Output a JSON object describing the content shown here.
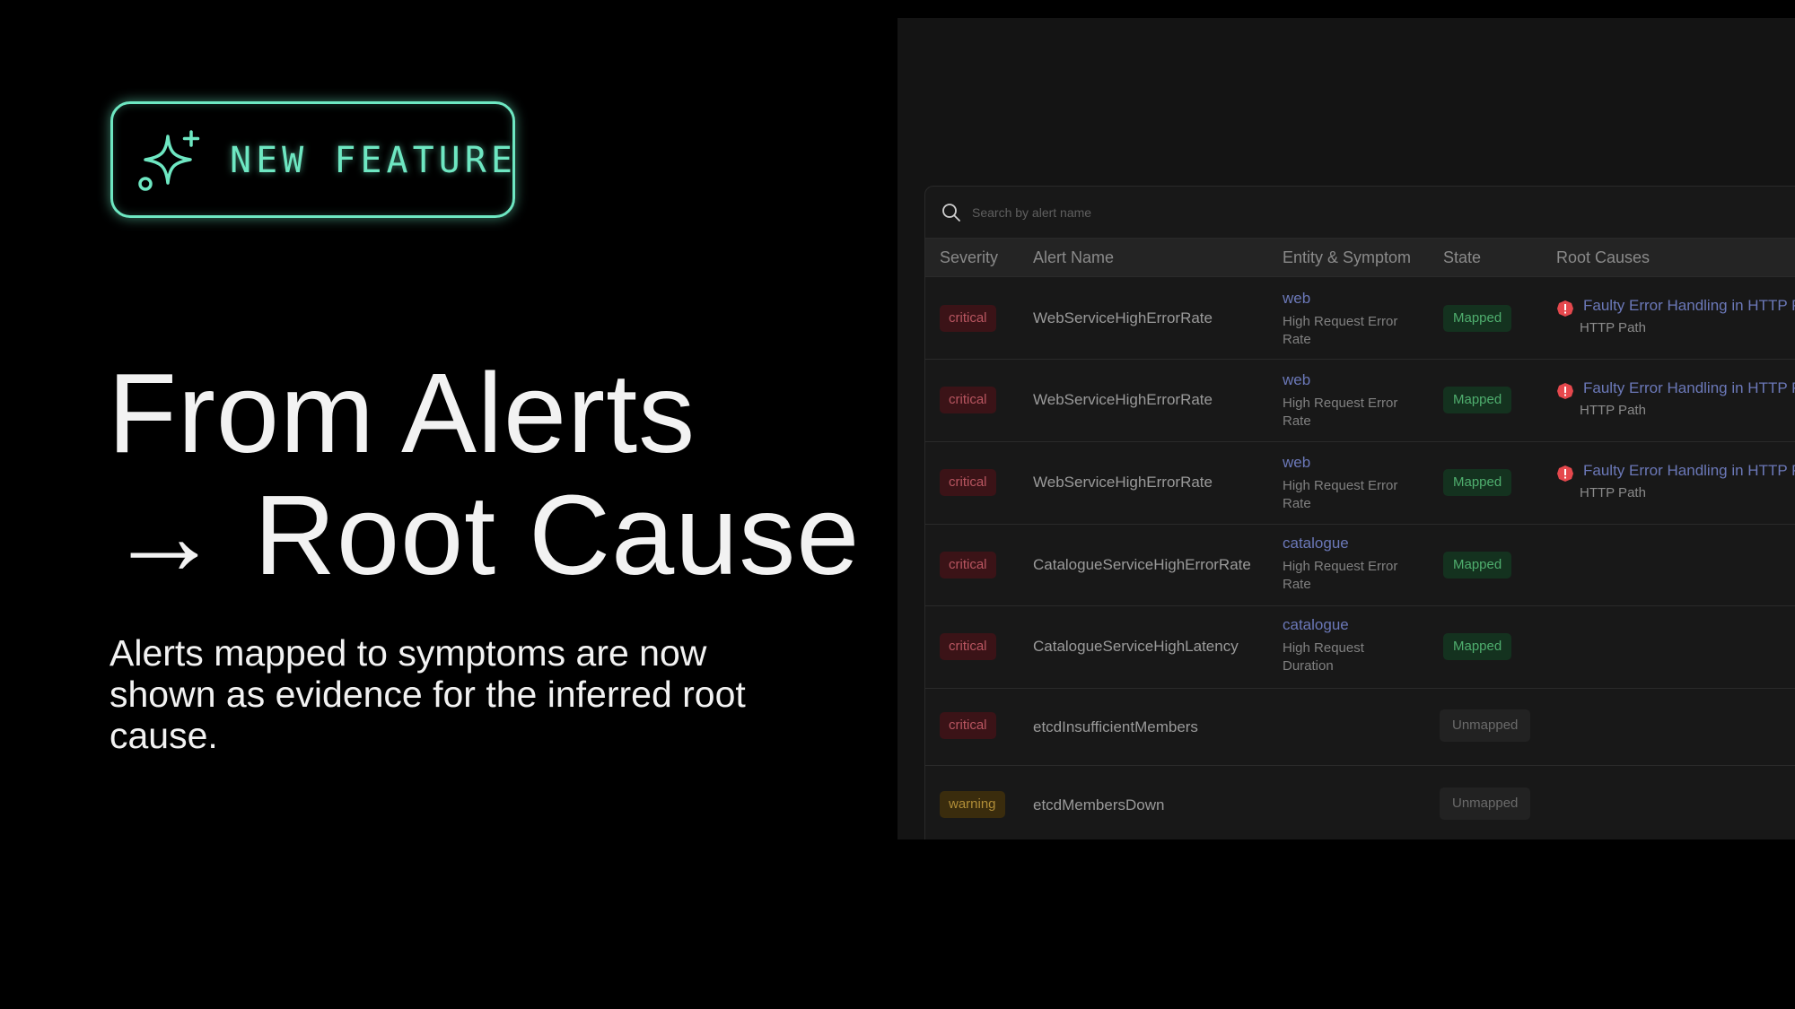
{
  "badge": {
    "label": "NEW FEATURE",
    "icon": "sparkles-icon",
    "color": "#6ee7c2"
  },
  "headline": {
    "line1": "From Alerts",
    "line2": "→ Root Cause"
  },
  "subtext": "Alerts mapped to symptoms are now shown as evidence for the inferred root cause.",
  "search": {
    "placeholder": "Search by alert name",
    "icon": "search-icon"
  },
  "columns": [
    "Severity",
    "Alert Name",
    "Entity & Symptom",
    "State",
    "Root Causes"
  ],
  "rows": [
    {
      "severity": "critical",
      "alert_name": "WebServiceHighErrorRate",
      "entity": "web",
      "symptom": "High Request Error Rate",
      "state": "Mapped",
      "root_cause": "Faulty Error Handling in HTTP P",
      "root_cause_sub": "HTTP Path"
    },
    {
      "severity": "critical",
      "alert_name": "WebServiceHighErrorRate",
      "entity": "web",
      "symptom": "High Request Error Rate",
      "state": "Mapped",
      "root_cause": "Faulty Error Handling in HTTP P",
      "root_cause_sub": "HTTP Path"
    },
    {
      "severity": "critical",
      "alert_name": "WebServiceHighErrorRate",
      "entity": "web",
      "symptom": "High Request Error Rate",
      "state": "Mapped",
      "root_cause": "Faulty Error Handling in HTTP P",
      "root_cause_sub": "HTTP Path"
    },
    {
      "severity": "critical",
      "alert_name": "CatalogueServiceHighErrorRate",
      "entity": "catalogue",
      "symptom": "High Request Error Rate",
      "state": "Mapped"
    },
    {
      "severity": "critical",
      "alert_name": "CatalogueServiceHighLatency",
      "entity": "catalogue",
      "symptom": "High Request Duration",
      "state": "Mapped"
    },
    {
      "severity": "critical",
      "alert_name": "etcdInsufficientMembers",
      "state": "Unmapped"
    },
    {
      "severity": "warning",
      "alert_name": "etcdMembersDown",
      "state": "Unmapped"
    }
  ],
  "colors": {
    "critical": "#b85560",
    "warning": "#b08d37",
    "mapped": "#4fae6e",
    "link": "#6b78b8",
    "alert_icon": "#e5484d"
  }
}
